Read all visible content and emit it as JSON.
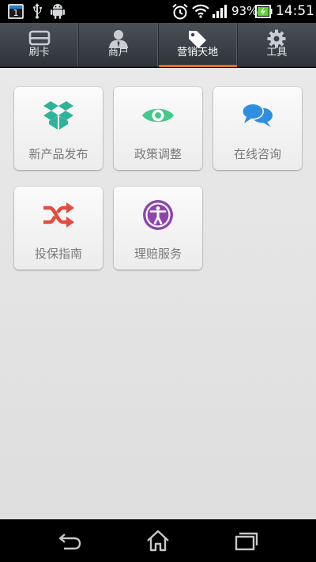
{
  "status_bar": {
    "calendar_day": "1",
    "battery_percent": "93%",
    "time": "14:51",
    "icons": [
      "calendar-icon",
      "usb-icon",
      "android-icon",
      "alarm-icon",
      "wifi-icon",
      "signal-icon",
      "battery-charging-icon"
    ]
  },
  "tabs": [
    {
      "label": "刷卡",
      "icon": "card-icon",
      "active": false
    },
    {
      "label": "商户",
      "icon": "person-icon",
      "active": false
    },
    {
      "label": "营销天地",
      "icon": "tag-icon",
      "active": true
    },
    {
      "label": "工具",
      "icon": "gear-icon",
      "active": false
    }
  ],
  "tiles": [
    {
      "label": "新产品发布",
      "icon": "open-box-icon",
      "color": "#2db39a"
    },
    {
      "label": "政策调整",
      "icon": "eye-icon",
      "color": "#46c98c"
    },
    {
      "label": "在线咨询",
      "icon": "chat-bubbles-icon",
      "color": "#2f8ee0"
    },
    {
      "label": "投保指南",
      "icon": "shuffle-icon",
      "color": "#e44b3f"
    },
    {
      "label": "理赔服务",
      "icon": "accessibility-icon",
      "color": "#8e44ad"
    }
  ],
  "nav_bar": {
    "buttons": [
      "back-icon",
      "home-icon",
      "recent-apps-icon"
    ]
  }
}
